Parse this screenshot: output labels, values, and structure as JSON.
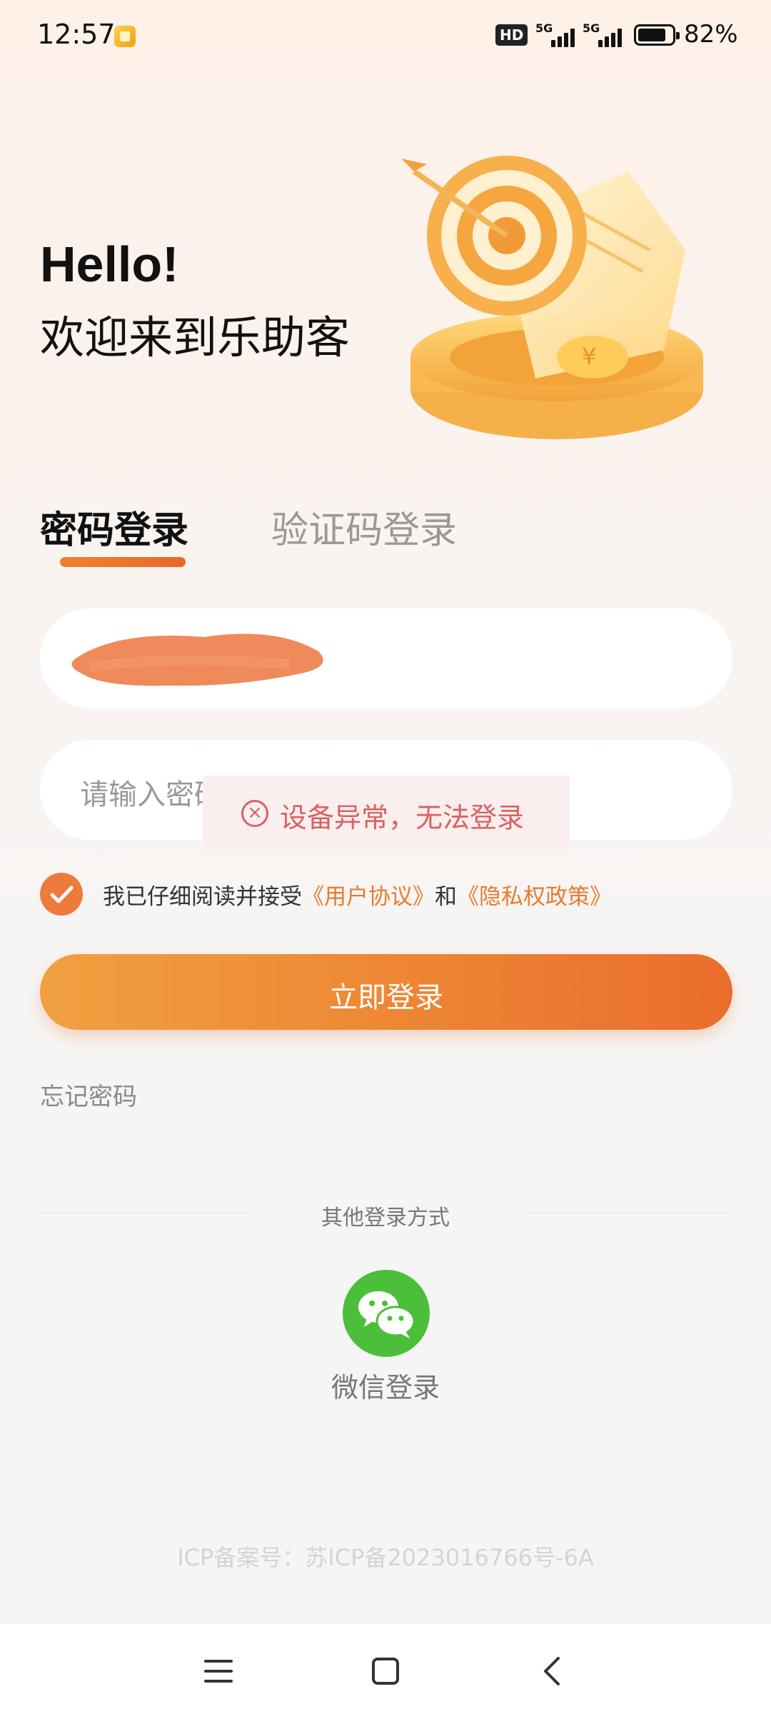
{
  "status_bar": {
    "time": "12:57",
    "network_hd": "HD",
    "signal_1": "5G",
    "signal_2": "5G",
    "battery_percent": "82%"
  },
  "header": {
    "hello": "Hello!",
    "welcome": "欢迎来到乐助客"
  },
  "tabs": [
    {
      "label": "密码登录",
      "active": true
    },
    {
      "label": "验证码登录",
      "active": false
    }
  ],
  "account_input": {
    "value": ""
  },
  "password_input": {
    "placeholder": "请输入密码"
  },
  "toast": {
    "message": "设备异常，无法登录",
    "icon": "close-circle-icon"
  },
  "agreement": {
    "checked": true,
    "prefix": "我已仔细阅读并接受",
    "user_agreement": "《用户协议》",
    "and": "和",
    "privacy_policy": "《隐私权政策》"
  },
  "login_button": {
    "label": "立即登录"
  },
  "forgot_password": {
    "label": "忘记密码"
  },
  "other_login": {
    "title": "其他登录方式",
    "wechat_label": "微信登录",
    "wechat_icon": "wechat-icon"
  },
  "footer": {
    "icp": "ICP备案号：苏ICP备2023016766号-6A"
  },
  "colors": {
    "accent": "#ee7a3c",
    "button_start": "#f0a040",
    "button_end": "#ea6d2c",
    "toast_text": "#d86262",
    "wechat": "#4cbf3a"
  }
}
